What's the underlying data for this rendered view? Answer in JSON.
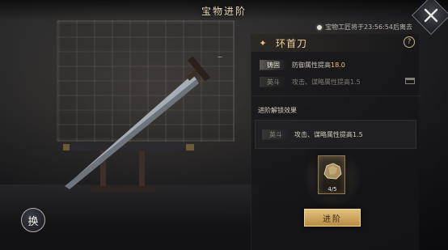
{
  "header": {
    "title": "宝物进阶"
  },
  "timer": {
    "text": "宝物工匠将于23:56:54后离去"
  },
  "weapon": {
    "name": "环首刀",
    "rank_icon": "rank-emblem-icon",
    "help_label": "?"
  },
  "attributes": [
    {
      "tag": "铸固",
      "text_prefix": "防御属性提高",
      "highlight": "18.0"
    },
    {
      "tag": "英斗",
      "text": "攻击、谋略属性提高1.5"
    }
  ],
  "unlock": {
    "title": "进阶解锁效果",
    "tag": "英斗",
    "text": "攻击、谋略属性提高1.5"
  },
  "material": {
    "count": "4/5"
  },
  "actions": {
    "advance_label": "进阶",
    "swap_label": "换"
  },
  "colors": {
    "accent_gold": "#e5c26b",
    "button_gold": "#d1a85f"
  }
}
